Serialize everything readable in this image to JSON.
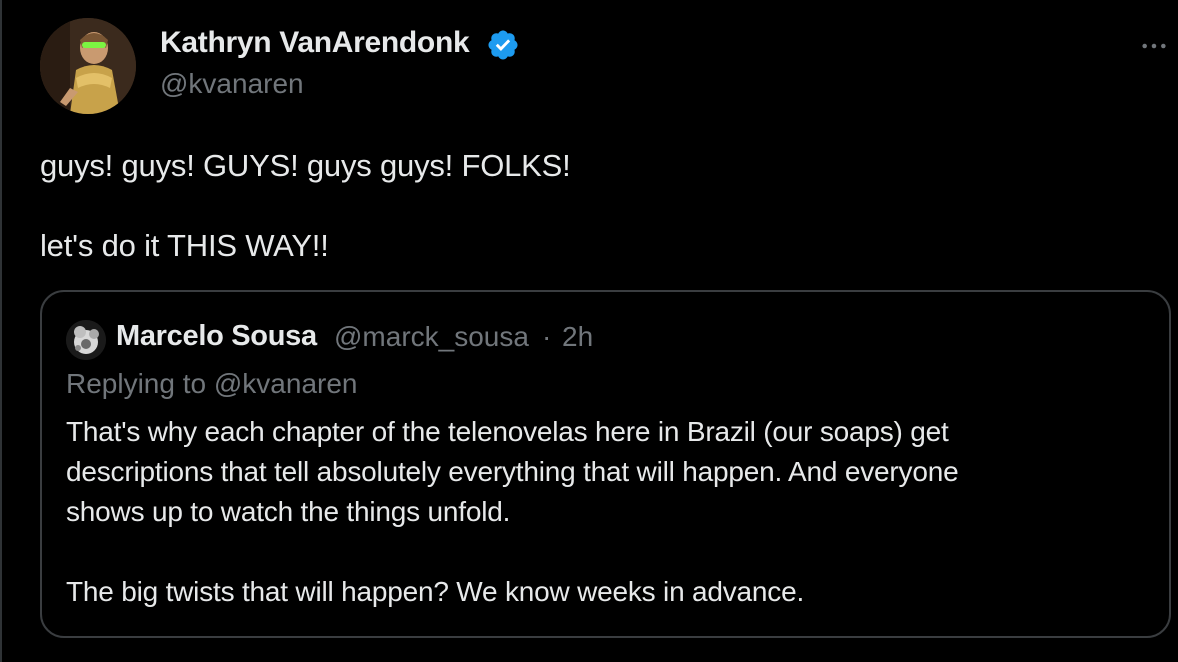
{
  "author": {
    "name": "Kathryn VanArendonk",
    "handle": "@kvanaren",
    "verified": true,
    "verified_color": "#1d9bf0"
  },
  "tweet": {
    "line1": "guys! guys! GUYS! guys guys! FOLKS!",
    "line2": "let's do it THIS WAY!!"
  },
  "quote": {
    "author_name": "Marcelo Sousa",
    "author_handle": "@marck_sousa",
    "separator": "·",
    "time": "2h",
    "replying_prefix": "Replying to ",
    "replying_to": "@kvanaren",
    "text_line1": "That's why each chapter of the telenovelas here in Brazil (our soaps) get",
    "text_line2": "descriptions that tell absolutely everything that will happen. And everyone",
    "text_line3": "shows up to watch the things unfold.",
    "text_line4": "The big twists that will happen? We know weeks in advance."
  },
  "colors": {
    "background": "#000000",
    "primary_text": "#e7e9ea",
    "secondary_text": "#71767b",
    "border": "#3a3d40"
  },
  "icons": {
    "more": "more-horizontal-icon",
    "verified": "verified-badge-icon"
  }
}
